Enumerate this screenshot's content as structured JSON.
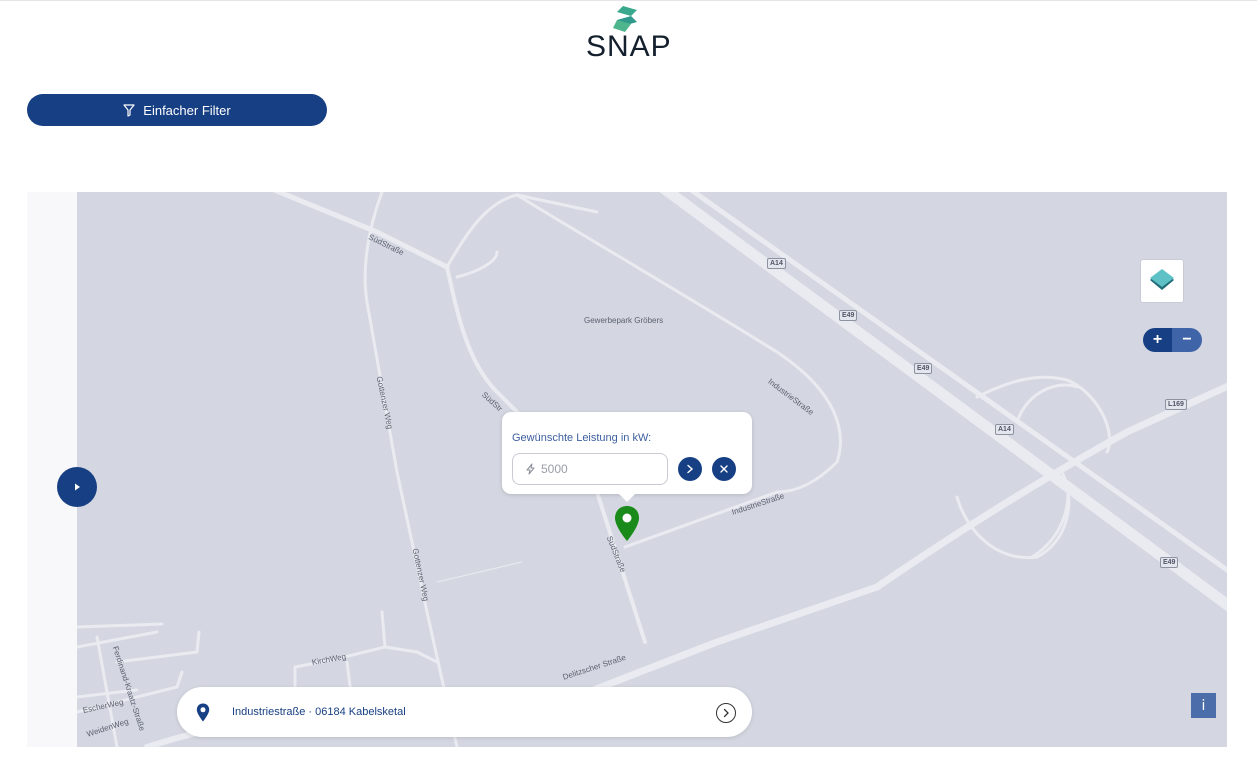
{
  "brand": {
    "logo_text": "SNAP"
  },
  "filter": {
    "label": "Einfacher Filter",
    "icon": "funnel-icon"
  },
  "map": {
    "poi": "Gewerbepark Gröbers",
    "streets": {
      "sued1": "SüdStraße",
      "sued2": "SüdStr",
      "sued3": "SüdStraße",
      "industrie1": "IndustrieStraße",
      "industrie2": "IndustrieStraße",
      "gottenz1": "Gottenzer Weg",
      "gottenz2": "Gottenzer Weg",
      "delitzscher": "Delitzscher Straße",
      "kirch": "KirchWeg",
      "escher": "EscherWeg",
      "weiden": "WeidenWeg",
      "ferdinand": "Ferdinand-Kraatz-Straße"
    },
    "shields": {
      "a14_1": "A14",
      "a14_2": "A14",
      "e49_1": "E49",
      "e49_2": "E49",
      "e49_3": "E49",
      "l169": "L169"
    },
    "colors": {
      "land": "#d4d7e1",
      "road": "#eaebf1",
      "accent": "#173f83",
      "marker": "#1a8a1a"
    }
  },
  "popup": {
    "label": "Gewünschte Leistung in kW:",
    "input_placeholder": "5000",
    "submit_icon": "chevron-right-icon",
    "close_icon": "close-icon"
  },
  "controls": {
    "zoom_in": "+",
    "zoom_out": "−",
    "info": "i",
    "layers_icon": "layers-icon"
  },
  "address": {
    "text": "Industriestraße · 06184 Kabelsketal",
    "icon": "location-pin-icon",
    "go_icon": "arrow-right-circle-icon"
  }
}
